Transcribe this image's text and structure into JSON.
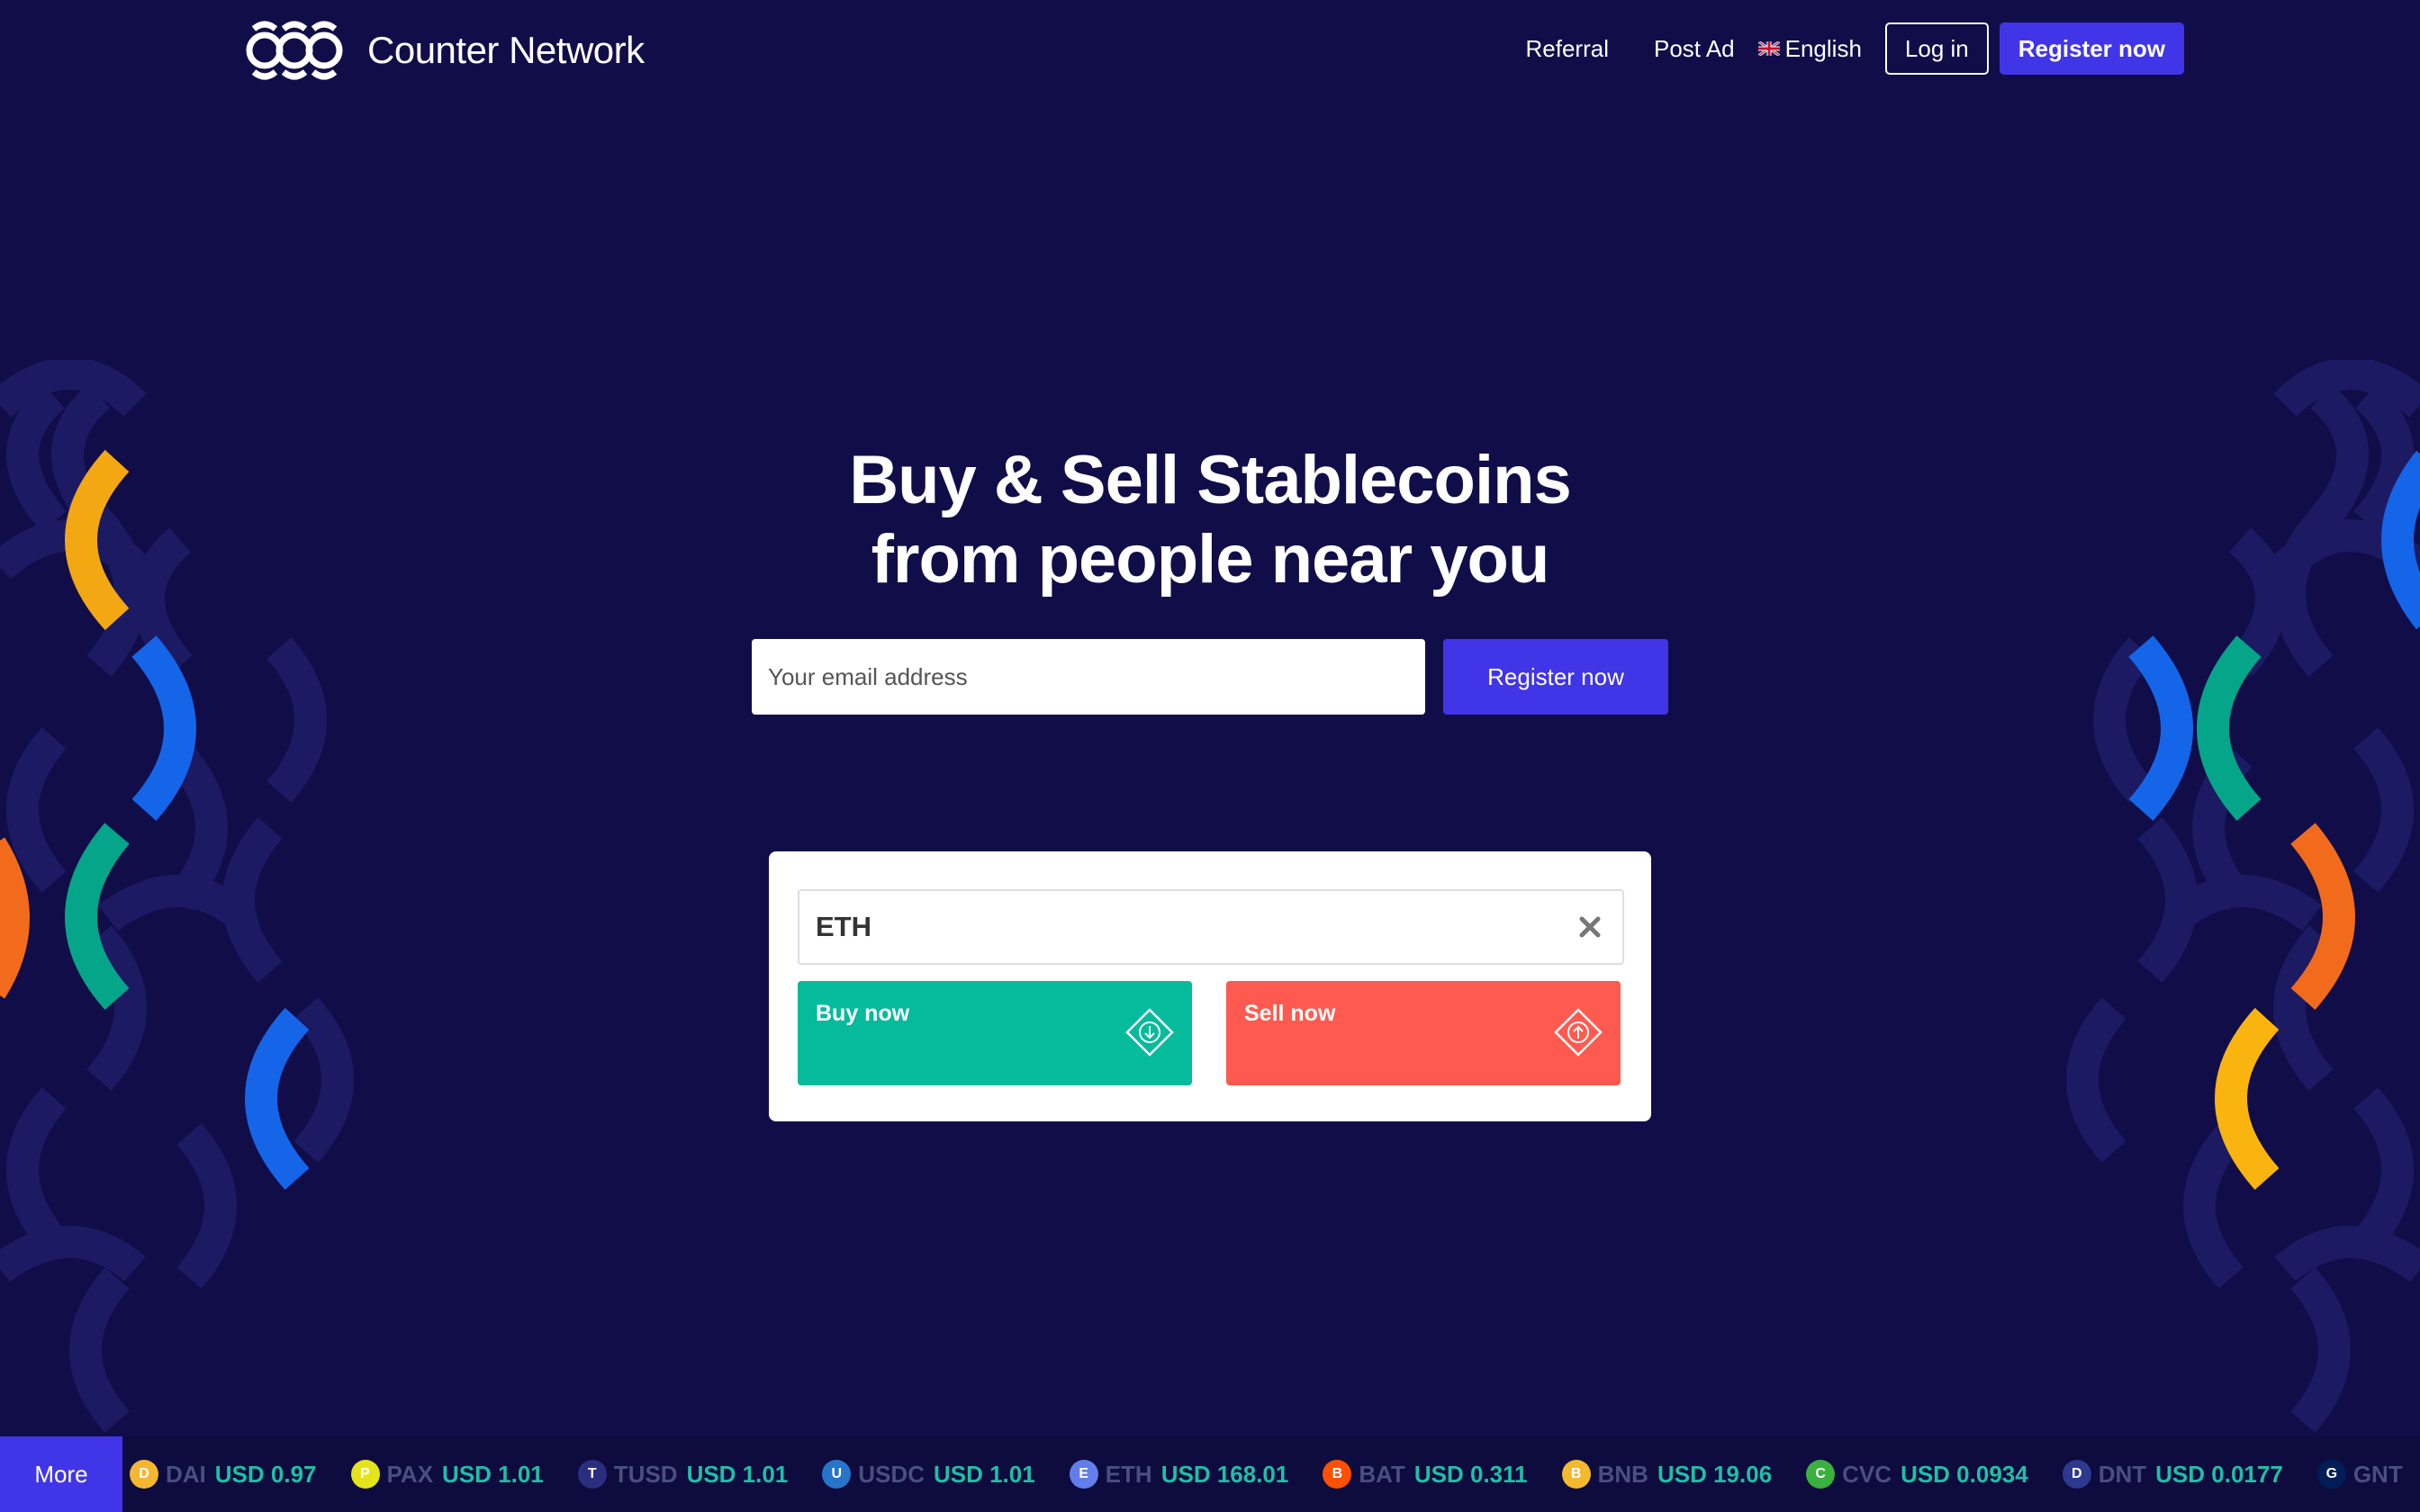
{
  "header": {
    "brand_name": "Counter Network",
    "nav": {
      "referral": "Referral",
      "post_ad": "Post Ad",
      "language": "English",
      "login": "Log in",
      "register": "Register now"
    }
  },
  "hero": {
    "title_line1": "Buy & Sell Stablecoins",
    "title_line2": "from people near you",
    "email_placeholder": "Your email address",
    "register_button": "Register now"
  },
  "trade": {
    "search_value": "ETH",
    "buy_label": "Buy now",
    "sell_label": "Sell now"
  },
  "ticker": {
    "more_label": "More",
    "items": [
      {
        "symbol": "DAI",
        "price": "USD 0.97",
        "icon_color": "#f4b731"
      },
      {
        "symbol": "PAX",
        "price": "USD 1.01",
        "icon_color": "#e5e41a"
      },
      {
        "symbol": "TUSD",
        "price": "USD 1.01",
        "icon_color": "#2b2e7f"
      },
      {
        "symbol": "USDC",
        "price": "USD 1.01",
        "icon_color": "#2775ca"
      },
      {
        "symbol": "ETH",
        "price": "USD 168.01",
        "icon_color": "#627eea"
      },
      {
        "symbol": "BAT",
        "price": "USD 0.311",
        "icon_color": "#ff5000"
      },
      {
        "symbol": "BNB",
        "price": "USD 19.06",
        "icon_color": "#f3ba2f"
      },
      {
        "symbol": "CVC",
        "price": "USD 0.0934",
        "icon_color": "#3ab03e"
      },
      {
        "symbol": "DNT",
        "price": "USD 0.0177",
        "icon_color": "#2c398f"
      },
      {
        "symbol": "GNT",
        "price": "",
        "icon_color": "#001d57"
      }
    ]
  },
  "colors": {
    "background": "#110d48",
    "accent": "#4135e8",
    "buy": "#05bb9c",
    "sell": "#fe5a4f"
  }
}
